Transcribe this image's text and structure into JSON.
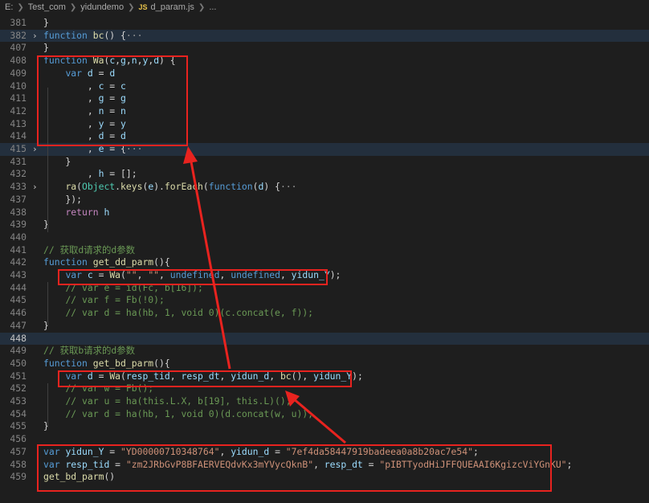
{
  "breadcrumb": {
    "drive": "E:",
    "folder1": "Test_com",
    "folder2": "yidundemo",
    "file_badge": "JS",
    "file": "d_param.js",
    "more": "..."
  },
  "lines": [
    {
      "num": "381",
      "parts": [
        [
          "p",
          "}"
        ]
      ]
    },
    {
      "num": "382",
      "fold": true,
      "hl": true,
      "parts": [
        [
          "k",
          "function "
        ],
        [
          "f",
          "bc"
        ],
        [
          "p",
          "() {"
        ],
        [
          "ellip",
          "···"
        ]
      ]
    },
    {
      "num": "407",
      "parts": [
        [
          "p",
          "}"
        ]
      ]
    },
    {
      "num": "408",
      "parts": [
        [
          "k",
          "function "
        ],
        [
          "f",
          "Wa"
        ],
        [
          "p",
          "("
        ],
        [
          "v",
          "c"
        ],
        [
          "p",
          ","
        ],
        [
          "v",
          "g"
        ],
        [
          "p",
          ","
        ],
        [
          "v",
          "n"
        ],
        [
          "p",
          ","
        ],
        [
          "v",
          "y"
        ],
        [
          "p",
          ","
        ],
        [
          "v",
          "d"
        ],
        [
          "p",
          ") {"
        ]
      ]
    },
    {
      "num": "409",
      "parts": [
        [
          "p",
          "    "
        ],
        [
          "k",
          "var "
        ],
        [
          "v",
          "d"
        ],
        [
          "p",
          " = "
        ],
        [
          "v",
          "d"
        ]
      ]
    },
    {
      "num": "410",
      "parts": [
        [
          "p",
          "        , "
        ],
        [
          "v",
          "c"
        ],
        [
          "p",
          " = "
        ],
        [
          "v",
          "c"
        ]
      ]
    },
    {
      "num": "411",
      "parts": [
        [
          "p",
          "        , "
        ],
        [
          "v",
          "g"
        ],
        [
          "p",
          " = "
        ],
        [
          "v",
          "g"
        ]
      ]
    },
    {
      "num": "412",
      "parts": [
        [
          "p",
          "        , "
        ],
        [
          "v",
          "n"
        ],
        [
          "p",
          " = "
        ],
        [
          "v",
          "n"
        ]
      ]
    },
    {
      "num": "413",
      "parts": [
        [
          "p",
          "        , "
        ],
        [
          "v",
          "y"
        ],
        [
          "p",
          " = "
        ],
        [
          "v",
          "y"
        ]
      ]
    },
    {
      "num": "414",
      "parts": [
        [
          "p",
          "        , "
        ],
        [
          "v",
          "d"
        ],
        [
          "p",
          " = "
        ],
        [
          "v",
          "d"
        ]
      ]
    },
    {
      "num": "415",
      "fold": true,
      "hl": true,
      "parts": [
        [
          "p",
          "        , "
        ],
        [
          "v",
          "e"
        ],
        [
          "p",
          " = {"
        ],
        [
          "ellip",
          "···"
        ]
      ]
    },
    {
      "num": "431",
      "parts": [
        [
          "p",
          "    }"
        ]
      ]
    },
    {
      "num": "432",
      "parts": [
        [
          "p",
          "        , "
        ],
        [
          "v",
          "h"
        ],
        [
          "p",
          " = [];"
        ]
      ]
    },
    {
      "num": "433",
      "fold": true,
      "parts": [
        [
          "p",
          "    "
        ],
        [
          "f",
          "ra"
        ],
        [
          "p",
          "("
        ],
        [
          "t",
          "Object"
        ],
        [
          "p",
          "."
        ],
        [
          "f",
          "keys"
        ],
        [
          "p",
          "("
        ],
        [
          "v",
          "e"
        ],
        [
          "p",
          ")."
        ],
        [
          "f",
          "forEach"
        ],
        [
          "p",
          "("
        ],
        [
          "k",
          "function"
        ],
        [
          "p",
          "("
        ],
        [
          "v",
          "d"
        ],
        [
          "p",
          ") {"
        ],
        [
          "ellip",
          "···"
        ]
      ]
    },
    {
      "num": "437",
      "parts": [
        [
          "p",
          "    });"
        ]
      ]
    },
    {
      "num": "438",
      "parts": [
        [
          "p",
          "    "
        ],
        [
          "c",
          "return "
        ],
        [
          "v",
          "h"
        ]
      ]
    },
    {
      "num": "439",
      "parts": [
        [
          "p",
          "}"
        ]
      ]
    },
    {
      "num": "440",
      "parts": []
    },
    {
      "num": "441",
      "parts": [
        [
          "cm",
          "// 获取d请求的d参数"
        ]
      ]
    },
    {
      "num": "442",
      "parts": [
        [
          "k",
          "function "
        ],
        [
          "f",
          "get_dd_parm"
        ],
        [
          "p",
          "(){"
        ]
      ]
    },
    {
      "num": "443",
      "parts": [
        [
          "p",
          "    "
        ],
        [
          "k",
          "var "
        ],
        [
          "v",
          "c"
        ],
        [
          "p",
          " = "
        ],
        [
          "f",
          "Wa"
        ],
        [
          "p",
          "("
        ],
        [
          "s",
          "\"\""
        ],
        [
          "p",
          ", "
        ],
        [
          "s",
          "\"\""
        ],
        [
          "p",
          ", "
        ],
        [
          "k",
          "undefined"
        ],
        [
          "p",
          ", "
        ],
        [
          "k",
          "undefined"
        ],
        [
          "p",
          ", "
        ],
        [
          "v",
          "yidun_Y"
        ],
        [
          "p",
          ");"
        ]
      ]
    },
    {
      "num": "444",
      "parts": [
        [
          "p",
          "    "
        ],
        [
          "cm",
          "// var e = id(Fc, b[16]);"
        ]
      ]
    },
    {
      "num": "445",
      "parts": [
        [
          "p",
          "    "
        ],
        [
          "cm",
          "// var f = Fb(!0);"
        ]
      ]
    },
    {
      "num": "446",
      "parts": [
        [
          "p",
          "    "
        ],
        [
          "cm",
          "// var d = ha(hb, 1, void 0)(c.concat(e, f));"
        ]
      ]
    },
    {
      "num": "447",
      "parts": [
        [
          "p",
          "}"
        ]
      ]
    },
    {
      "num": "448",
      "cur": true,
      "hl": true,
      "parts": []
    },
    {
      "num": "449",
      "parts": [
        [
          "cm",
          "// 获取b请求的d参数"
        ]
      ]
    },
    {
      "num": "450",
      "parts": [
        [
          "k",
          "function "
        ],
        [
          "f",
          "get_bd_parm"
        ],
        [
          "p",
          "(){"
        ]
      ]
    },
    {
      "num": "451",
      "parts": [
        [
          "p",
          "    "
        ],
        [
          "k",
          "var "
        ],
        [
          "v",
          "d"
        ],
        [
          "p",
          " = "
        ],
        [
          "f",
          "Wa"
        ],
        [
          "p",
          "("
        ],
        [
          "v",
          "resp_tid"
        ],
        [
          "p",
          ", "
        ],
        [
          "v",
          "resp_dt"
        ],
        [
          "p",
          ", "
        ],
        [
          "v",
          "yidun_d"
        ],
        [
          "p",
          ", "
        ],
        [
          "f",
          "bc"
        ],
        [
          "p",
          "(), "
        ],
        [
          "v",
          "yidun_Y"
        ],
        [
          "p",
          ");"
        ]
      ]
    },
    {
      "num": "452",
      "parts": [
        [
          "p",
          "    "
        ],
        [
          "cm",
          "// var w = Fb();"
        ]
      ]
    },
    {
      "num": "453",
      "parts": [
        [
          "p",
          "    "
        ],
        [
          "cm",
          "// var u = ha(this.L.X, b[19], this.L)();"
        ]
      ]
    },
    {
      "num": "454",
      "parts": [
        [
          "p",
          "    "
        ],
        [
          "cm",
          "// var d = ha(hb, 1, void 0)(d.concat(w, u));"
        ]
      ]
    },
    {
      "num": "455",
      "parts": [
        [
          "p",
          "}"
        ]
      ]
    },
    {
      "num": "456",
      "parts": []
    },
    {
      "num": "457",
      "parts": [
        [
          "k",
          "var "
        ],
        [
          "v",
          "yidun_Y"
        ],
        [
          "p",
          " = "
        ],
        [
          "s",
          "\"YD00000710348764\""
        ],
        [
          "p",
          ", "
        ],
        [
          "v",
          "yidun_d"
        ],
        [
          "p",
          " = "
        ],
        [
          "s",
          "\"7ef4da58447919badeea0a8b20ac7e54\""
        ],
        [
          "p",
          ";"
        ]
      ]
    },
    {
      "num": "458",
      "parts": [
        [
          "k",
          "var "
        ],
        [
          "v",
          "resp_tid"
        ],
        [
          "p",
          " = "
        ],
        [
          "s",
          "\"zm2JRbGvP8BFAERVEQdvKx3mYVycQknB\""
        ],
        [
          "p",
          ", "
        ],
        [
          "v",
          "resp_dt"
        ],
        [
          "p",
          " = "
        ],
        [
          "s",
          "\"pIBTTyodHiJFFQUEAAI6KgizcViYGnKU\""
        ],
        [
          "p",
          ";"
        ]
      ]
    },
    {
      "num": "459",
      "parts": [
        [
          "f",
          "get_bd_parm"
        ],
        [
          "p",
          "()"
        ]
      ]
    }
  ],
  "colors": {
    "background": "#1e1e1e",
    "keyword": "#569cd6",
    "control": "#c586c0",
    "function": "#dcdcaa",
    "variable": "#9cdcfe",
    "string": "#ce9178",
    "comment": "#6a9955",
    "type": "#4ec9b0",
    "annotation_red": "#e8231f"
  },
  "icons": {
    "fold": "chevron-right-icon",
    "file": "javascript-file-icon"
  }
}
